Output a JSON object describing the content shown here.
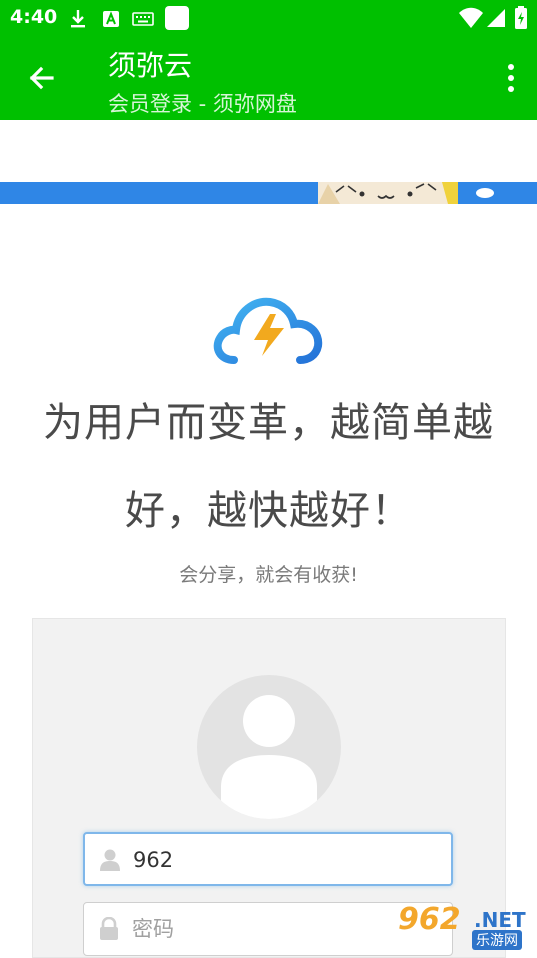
{
  "status_bar": {
    "time": "4:40",
    "icons": [
      "download-icon",
      "font-a-icon",
      "keyboard-icon",
      "blank-square-icon",
      "wifi-icon",
      "signal-icon",
      "battery-icon"
    ],
    "color": "#00c000"
  },
  "app_bar": {
    "title": "须弥云",
    "subtitle": "会员登录 - 须弥网盘",
    "back_icon": "arrow-left-icon",
    "menu_icon": "more-vert-icon",
    "color": "#00c000"
  },
  "page": {
    "logo_icon": "cloud-lightning-icon",
    "slogan_line1": "为用户而变革，越简单越",
    "slogan_line2": "好，越快越好！",
    "sub_slogan": "会分享，就会有收获!"
  },
  "login": {
    "avatar_icon": "user-avatar-icon",
    "username_value": "962",
    "username_icon": "user-icon",
    "password_placeholder": "密码",
    "password_icon": "lock-icon"
  },
  "watermark": {
    "big": "962",
    "net": ".NET",
    "cn": "乐游网"
  }
}
